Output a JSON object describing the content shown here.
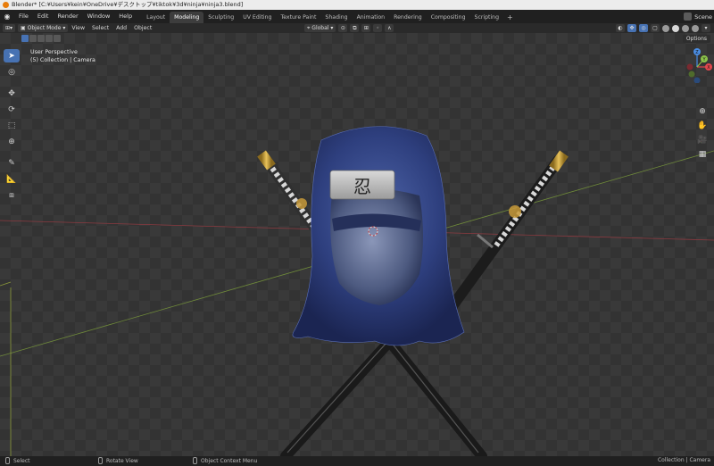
{
  "window": {
    "title": "Blender* [C:¥Users¥kein¥OneDrive¥デスクトップ¥tiktok¥3d¥ninja¥ninja3.blend]"
  },
  "menubar": {
    "items": [
      "File",
      "Edit",
      "Render",
      "Window",
      "Help"
    ],
    "workspaces": [
      {
        "label": "Layout",
        "active": false
      },
      {
        "label": "Modeling",
        "active": true
      },
      {
        "label": "Sculpting",
        "active": false
      },
      {
        "label": "UV Editing",
        "active": false
      },
      {
        "label": "Texture Paint",
        "active": false
      },
      {
        "label": "Shading",
        "active": false
      },
      {
        "label": "Animation",
        "active": false
      },
      {
        "label": "Rendering",
        "active": false
      },
      {
        "label": "Compositing",
        "active": false
      },
      {
        "label": "Scripting",
        "active": false
      }
    ],
    "add_tab": "+",
    "scene_label": "Scene"
  },
  "header": {
    "mode": "Object Mode",
    "menus": [
      "View",
      "Select",
      "Add",
      "Object"
    ],
    "transform_orientation": "Global",
    "options_label": "Options"
  },
  "viewport": {
    "perspective": "User Perspective",
    "collection": "(5) Collection | Camera",
    "headband_glyph": "忍"
  },
  "gizmo": {
    "z_label": "Z",
    "y_label": "Y",
    "x_label": "X"
  },
  "statusbar": {
    "select": "Select",
    "rotate": "Rotate View",
    "context": "Object Context Menu",
    "right": "Collection | Camera"
  },
  "colors": {
    "accent": "#4772b3",
    "x_axis": "#e4474e",
    "y_axis": "#8bc24a",
    "z_axis": "#4a8de4"
  }
}
